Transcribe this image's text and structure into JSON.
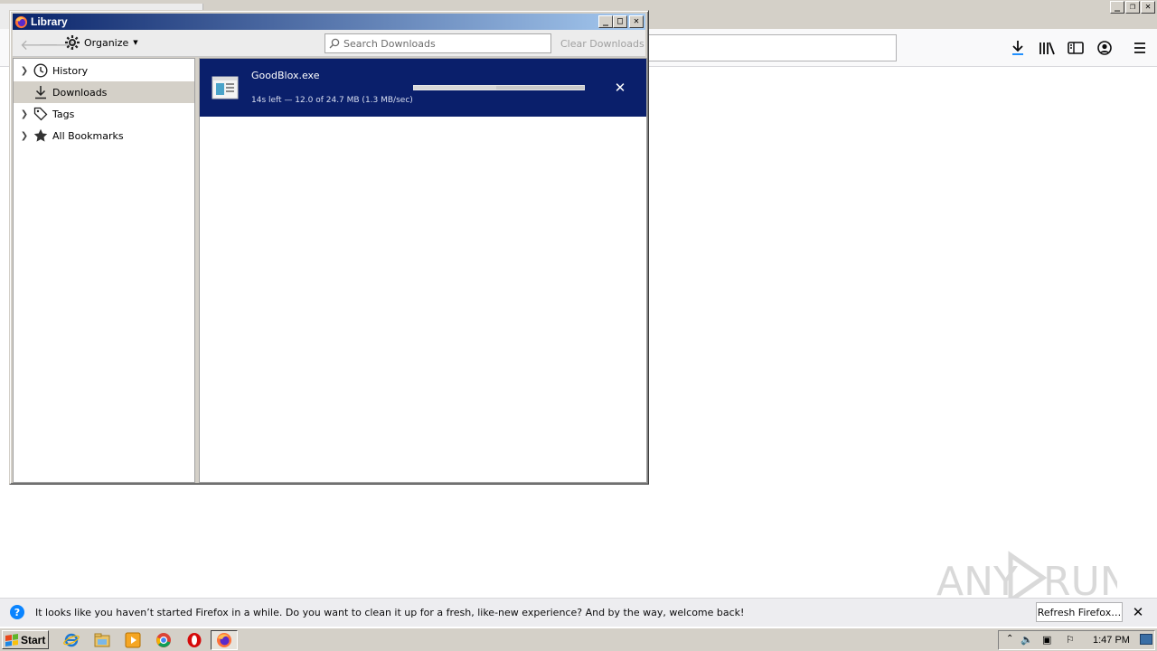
{
  "library": {
    "title": "Library",
    "toolbar": {
      "back_icon": "back-arrow-icon",
      "forward_icon": "forward-arrow-icon",
      "organize_label": "Organize",
      "search_placeholder": "Search Downloads",
      "clear_label": "Clear Downloads"
    },
    "sidebar": {
      "items": [
        {
          "label": "History",
          "icon": "clock-icon",
          "expandable": true,
          "selected": false
        },
        {
          "label": "Downloads",
          "icon": "download-icon",
          "expandable": false,
          "selected": true
        },
        {
          "label": "Tags",
          "icon": "tag-icon",
          "expandable": true,
          "selected": false
        },
        {
          "label": "All Bookmarks",
          "icon": "star-icon",
          "expandable": true,
          "selected": false
        }
      ]
    },
    "downloads": [
      {
        "filename": "GoodBlox.exe",
        "status": "14s left — 12.0 of 24.7 MB (1.3 MB/sec)",
        "progress": 0.486,
        "icon": "executable-file-icon"
      }
    ],
    "colors": {
      "selected_download_bg": "#0a1f6b",
      "titlebar_start": "#0a246a",
      "titlebar_end": "#a6caf0"
    }
  },
  "browser": {
    "toolbar_icons": [
      "download-icon",
      "library-icon",
      "sidebar-icon",
      "account-icon",
      "menu-icon"
    ]
  },
  "notification": {
    "text": "It looks like you haven’t started Firefox in a while. Do you want to clean it up for a fresh, like-new experience? And by the way, welcome back!",
    "button_label": "Refresh Firefox…"
  },
  "taskbar": {
    "start_label": "Start",
    "pinned": [
      "internet-explorer-icon",
      "file-explorer-icon",
      "media-player-icon",
      "chrome-icon",
      "opera-icon",
      "firefox-icon"
    ],
    "time": "1:47 PM"
  },
  "watermark": {
    "text_left": "ANY",
    "text_right": "RUN"
  }
}
